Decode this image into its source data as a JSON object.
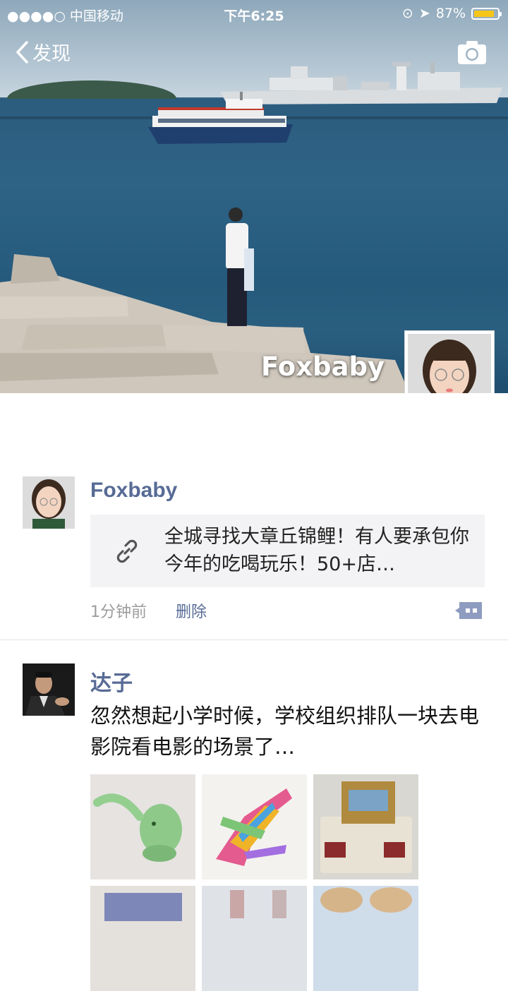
{
  "status_bar": {
    "carrier": "●●●●○ 中国移动",
    "time": "下午6:25",
    "battery_text": "87%",
    "battery_level": 0.87,
    "battery_color": "#f5c518"
  },
  "nav": {
    "back_label": "发现",
    "camera_icon": "camera-icon"
  },
  "cover": {
    "name": "Foxbaby"
  },
  "posts": [
    {
      "name": "Foxbaby",
      "link_text": "全城寻找大章丘锦鲤！有人要承包你今年的吃喝玩乐！50+店…",
      "time": "1分钟前",
      "delete_label": "删除"
    },
    {
      "name": "达子",
      "text": "忽然想起小学时候，学校组织排队一块去电影院看电影的场景了…"
    }
  ],
  "colors": {
    "name_blue": "#576b95",
    "link_bg": "#f3f3f5"
  }
}
